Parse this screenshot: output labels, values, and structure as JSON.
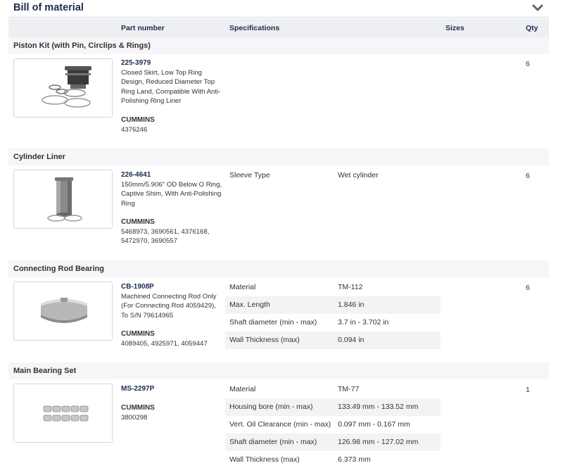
{
  "section": {
    "title": "Bill of material"
  },
  "columns": {
    "part_number": "Part number",
    "specifications": "Specifications",
    "sizes": "Sizes",
    "qty": "Qty"
  },
  "groups": [
    {
      "title": "Piston Kit (with Pin, Circlips & Rings)",
      "part_number": "225-3979",
      "description": "Closed Skirt, Low Top Ring Design, Reduced Diameter Top Ring Land, Compatible With Anti-Polishing Ring Liner",
      "brand": "CUMMINS",
      "oem_numbers": "4376246",
      "qty": "6",
      "specs": []
    },
    {
      "title": "Cylinder Liner",
      "part_number": "226-4641",
      "description": "150mm/5.906\" OD Below O Ring, Captive Shim, With Anti-Polishing Ring",
      "brand": "CUMMINS",
      "oem_numbers": "5468973, 3690561, 4376168, 5472970, 3690557",
      "qty": "6",
      "specs": [
        {
          "label": "Sleeve Type",
          "value": "Wet cylinder"
        }
      ]
    },
    {
      "title": "Connecting Rod Bearing",
      "part_number": "CB-1908P",
      "description": "Machined Connecting Rod Only (For Connecting Rod 4059429), To S/N 79614965",
      "brand": "CUMMINS",
      "oem_numbers": "4089405, 4925971, 4059447",
      "qty": "6",
      "specs": [
        {
          "label": "Material",
          "value": "TM-112"
        },
        {
          "label": "Max. Length",
          "value": "1.846 in"
        },
        {
          "label": "Shaft diameter (min - max)",
          "value": "3.7 in - 3.702 in"
        },
        {
          "label": "Wall Thickness (max)",
          "value": "0.094 in"
        }
      ]
    },
    {
      "title": "Main Bearing Set",
      "part_number": "MS-2297P",
      "description": "",
      "brand": "CUMMINS",
      "oem_numbers": "3800298",
      "qty": "1",
      "specs": [
        {
          "label": "Material",
          "value": "TM-77"
        },
        {
          "label": "Housing bore (min - max)",
          "value": "133.49 mm - 133.52 mm"
        },
        {
          "label": "Vert. Oil Clearance (min - max)",
          "value": "0.097 mm - 0.167 mm"
        },
        {
          "label": "Shaft diameter (min - max)",
          "value": "126.98 mm - 127.02 mm"
        },
        {
          "label": "Wall Thickness (max)",
          "value": "6.373 mm"
        }
      ]
    }
  ],
  "icons": {
    "collapse": "chevron-down-icon"
  },
  "colors": {
    "header_text": "#1d2b4f",
    "column_header_bg": "#eeeff3",
    "group_header_bg": "#f6f6f8"
  }
}
